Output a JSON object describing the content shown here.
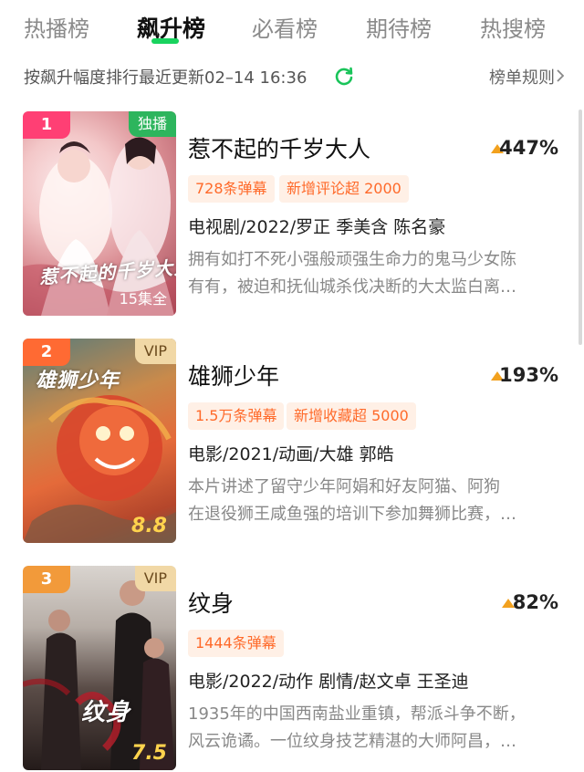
{
  "tabs": [
    {
      "label": "热播榜"
    },
    {
      "label": "飙升榜"
    },
    {
      "label": "必看榜"
    },
    {
      "label": "期待榜"
    },
    {
      "label": "热搜榜"
    }
  ],
  "active_tab": "飙升榜",
  "accent_color": "#19d35e",
  "sort_text": "按飙升幅度排行最近更新02–14 16:36",
  "rules_label": "榜单规则",
  "items": [
    {
      "rank": "1",
      "badge": "独播",
      "poster_title": "惹不起的千岁大人",
      "poster_footer": "15集全",
      "title": "惹不起的千岁大人",
      "heat": "447%",
      "chips": [
        "728条弹幕",
        "新增评论超 2000"
      ],
      "meta": "电视剧/2022/罗正  季美含  陈名豪",
      "desc": [
        "拥有如打不死小强般顽强生命力的鬼马少女陈",
        "有有，被迫和抚仙城杀伐决断的大太监白离…"
      ]
    },
    {
      "rank": "2",
      "badge": "VIP",
      "poster_title": "雄狮少年",
      "poster_footer": "8.8",
      "title": "雄狮少年",
      "heat": "193%",
      "chips": [
        "1.5万条弹幕",
        "新增收藏超 5000"
      ],
      "meta": "电影/2021/动画/大雄  郭皓",
      "desc": [
        "  本片讲述了留守少年阿娟和好友阿猫、阿狗",
        "在退役狮王咸鱼强的培训下参加舞狮比赛，…"
      ]
    },
    {
      "rank": "3",
      "badge": "VIP",
      "poster_title": "纹身",
      "poster_footer": "7.5",
      "title": "纹身",
      "heat": "82%",
      "chips": [
        "1444条弹幕"
      ],
      "meta": "电影/2022/动作  剧情/赵文卓  王圣迪",
      "desc": [
        "1935年的中国西南盐业重镇，帮派斗争不断，",
        "风云诡谲。一位纹身技艺精湛的大师阿昌，…"
      ]
    }
  ]
}
